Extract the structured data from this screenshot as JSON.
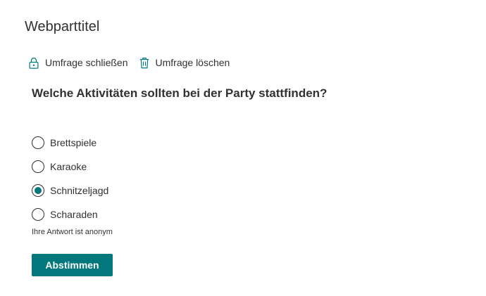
{
  "webpart": {
    "title": "Webparttitel"
  },
  "toolbar": {
    "close_poll": {
      "label": "Umfrage schließen",
      "icon": "lock-icon"
    },
    "delete_poll": {
      "label": "Umfrage löschen",
      "icon": "trash-icon"
    }
  },
  "poll": {
    "question": "Welche Aktivitäten sollten bei der Party stattfinden?",
    "options": [
      {
        "label": "Brettspiele",
        "selected": false
      },
      {
        "label": "Karaoke",
        "selected": false
      },
      {
        "label": "Schnitzeljagd",
        "selected": true
      },
      {
        "label": "Scharaden",
        "selected": false
      }
    ],
    "anonymity_note": "Ihre Antwort ist anonym",
    "submit_label": "Abstimmen"
  },
  "colors": {
    "accent": "#03787c",
    "text": "#323130",
    "background": "#ffffff"
  }
}
